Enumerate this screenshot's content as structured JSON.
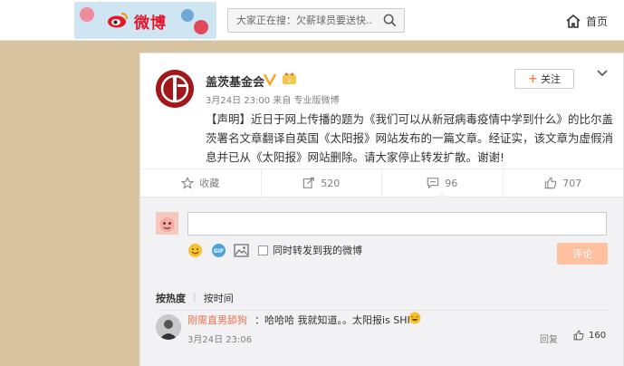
{
  "header": {
    "logo_text": "微博",
    "search_placeholder": "大家正在搜：欠薪球员要送快...",
    "home_label": "首页"
  },
  "post": {
    "author": "盖茨基金会",
    "meta": "3月24日 23:00 来自 专业版微博",
    "follow_label": "关注",
    "content": "【声明】近日于网上传播的题为《我们可以从新冠病毒疫情中学到什么》的比尔盖茨署名文章翻译自英国《太阳报》网站发布的一篇文章。经证实，该文章为虚假消息并已从《太阳报》网站删除。请大家停止转发扩散。谢谢!",
    "actions": [
      {
        "icon": "star-icon",
        "label": "收藏"
      },
      {
        "icon": "repost-icon",
        "label": "520"
      },
      {
        "icon": "comment-icon",
        "label": "96"
      },
      {
        "icon": "thumbs-up-icon",
        "label": "707"
      }
    ]
  },
  "comment_box": {
    "repost_label": "同时转发到我的微博",
    "submit_label": "评论"
  },
  "sort": {
    "hot": "按热度",
    "time": "按时间"
  },
  "comments": [
    {
      "user": "刚需直男舔狗",
      "text": "：哈哈哈 我就知道。。太阳报is SHIT",
      "time": "3月24日 23:06",
      "reply_label": "回复",
      "likes": "160"
    }
  ],
  "colors": {
    "accent": "#ff8140",
    "brand_red": "#e6162d",
    "username": "#eb7350"
  }
}
